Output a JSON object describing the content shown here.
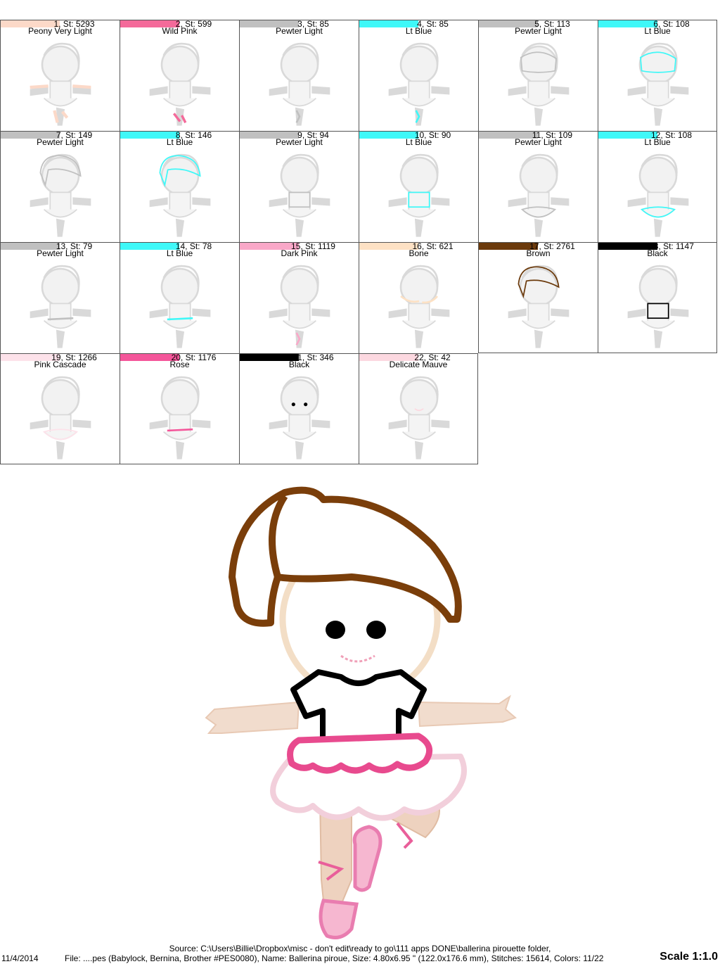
{
  "colors": [
    {
      "label": "1, St: 5293",
      "name": "Peony Very Light",
      "hex": "#fcd9c8",
      "part": "arms"
    },
    {
      "label": "2, St: 599",
      "name": "Wild Pink",
      "hex": "#f46a9a",
      "part": "shoes"
    },
    {
      "label": "3, St: 85",
      "name": "Pewter Light",
      "hex": "#c0c0c0",
      "part": "ribbon"
    },
    {
      "label": "4, St: 85",
      "name": "Lt Blue",
      "hex": "#3ff8f8",
      "part": "ribbon"
    },
    {
      "label": "5, St: 113",
      "name": "Pewter Light",
      "hex": "#c0c0c0",
      "part": "face"
    },
    {
      "label": "6, St: 108",
      "name": "Lt Blue",
      "hex": "#3ff8f8",
      "part": "face"
    },
    {
      "label": "7, St: 149",
      "name": "Pewter Light",
      "hex": "#c0c0c0",
      "part": "hair"
    },
    {
      "label": "8, St: 146",
      "name": "Lt Blue",
      "hex": "#3ff8f8",
      "part": "hair"
    },
    {
      "label": "9, St: 94",
      "name": "Pewter Light",
      "hex": "#c0c0c0",
      "part": "shirt"
    },
    {
      "label": "10, St: 90",
      "name": "Lt Blue",
      "hex": "#3ff8f8",
      "part": "shirt"
    },
    {
      "label": "11, St: 109",
      "name": "Pewter Light",
      "hex": "#c0c0c0",
      "part": "skirt"
    },
    {
      "label": "12, St: 108",
      "name": "Lt Blue",
      "hex": "#3ff8f8",
      "part": "skirt"
    },
    {
      "label": "13, St: 79",
      "name": "Pewter Light",
      "hex": "#c0c0c0",
      "part": "waist"
    },
    {
      "label": "14, St: 78",
      "name": "Lt Blue",
      "hex": "#3ff8f8",
      "part": "waist"
    },
    {
      "label": "15, St: 1119",
      "name": "Dark Pink",
      "hex": "#f9a8c8",
      "part": "ribbon"
    },
    {
      "label": "16, St: 621",
      "name": "Bone",
      "hex": "#fde1c4",
      "part": "faceSides"
    },
    {
      "label": "17, St: 2761",
      "name": "Brown",
      "hex": "#6b3a0c",
      "part": "hair"
    },
    {
      "label": "18, St: 1147",
      "name": "Black",
      "hex": "#000000",
      "part": "shirt"
    },
    {
      "label": "19, St: 1266",
      "name": "Pink Cascade",
      "hex": "#fde2ea",
      "part": "skirt"
    },
    {
      "label": "20, St: 1176",
      "name": "Rose",
      "hex": "#f4569a",
      "part": "waist"
    },
    {
      "label": "21, St: 346",
      "name": "Black",
      "hex": "#000000",
      "part": "eyes"
    },
    {
      "label": "22, St: 42",
      "name": "Delicate Mauve",
      "hex": "#fcd8e0",
      "part": "mouth"
    }
  ],
  "footer": {
    "source": "Source: C:\\Users\\Billie\\Dropbox\\misc - don't edit\\ready to go\\111 apps DONE\\ballerina pirouette folder,",
    "date": "11/4/2014",
    "file": "File: ....pes (Babylock, Bernina, Brother #PES0080), Name: Ballerina piroue, Size: 4.80x6.95 \" (122.0x176.6 mm), Stitches: 15614, Colors: 11/22",
    "scale": "Scale 1:1.0"
  }
}
